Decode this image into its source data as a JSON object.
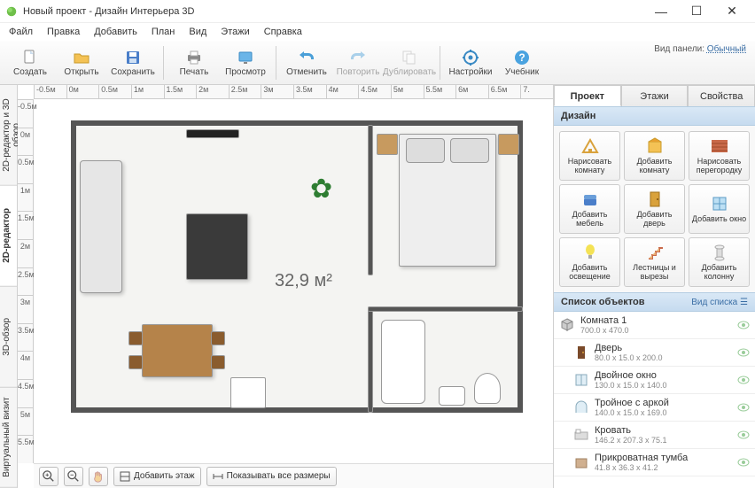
{
  "title": "Новый проект - Дизайн Интерьера 3D",
  "window": {
    "min": "—",
    "max": "☐",
    "close": "✕"
  },
  "menu": [
    "Файл",
    "Правка",
    "Добавить",
    "План",
    "Вид",
    "Этажи",
    "Справка"
  ],
  "toolbar": {
    "create": "Создать",
    "open": "Открыть",
    "save": "Сохранить",
    "print": "Печать",
    "view": "Просмотр",
    "undo": "Отменить",
    "redo": "Повторить",
    "duplicate": "Дублировать",
    "settings": "Настройки",
    "help": "Учебник"
  },
  "viewpanel": {
    "label": "Вид панели:",
    "value": "Обычный"
  },
  "left_tabs": [
    "2D-редактор и 3D обзор",
    "2D-редактор",
    "3D-обзор",
    "Виртуальный визит"
  ],
  "ruler_h": [
    "-0.5м",
    "0м",
    "0.5м",
    "1м",
    "1.5м",
    "2м",
    "2.5м",
    "3м",
    "3.5м",
    "4м",
    "4.5м",
    "5м",
    "5.5м",
    "6м",
    "6.5м",
    "7."
  ],
  "ruler_v": [
    "-0.5м",
    "0м",
    "0.5м",
    "1м",
    "1.5м",
    "2м",
    "2.5м",
    "3м",
    "3.5м",
    "4м",
    "4.5м",
    "5м",
    "5.5м"
  ],
  "area_label": "32,9 м²",
  "footer": {
    "add_floor": "Добавить этаж",
    "show_all": "Показывать все размеры"
  },
  "rtabs": [
    "Проект",
    "Этажи",
    "Свойства"
  ],
  "design_header": "Дизайн",
  "design": [
    "Нарисовать комнату",
    "Добавить комнату",
    "Нарисовать перегородку",
    "Добавить мебель",
    "Добавить дверь",
    "Добавить окно",
    "Добавить освещение",
    "Лестницы и вырезы",
    "Добавить колонну"
  ],
  "objects_header": "Список объектов",
  "objects_view": "Вид списка",
  "objects": [
    {
      "name": "Комната 1",
      "dims": "700.0 x 470.0",
      "indent": false,
      "icon": "cube"
    },
    {
      "name": "Дверь",
      "dims": "80.0 x 15.0 x 200.0",
      "indent": true,
      "icon": "door"
    },
    {
      "name": "Двойное окно",
      "dims": "130.0 x 15.0 x 140.0",
      "indent": true,
      "icon": "window"
    },
    {
      "name": "Тройное с аркой",
      "dims": "140.0 x 15.0 x 169.0",
      "indent": true,
      "icon": "arch"
    },
    {
      "name": "Кровать",
      "dims": "146.2 x 207.3 x 75.1",
      "indent": true,
      "icon": "bed"
    },
    {
      "name": "Прикроватная тумба",
      "dims": "41.8 x 36.3 x 41.2",
      "indent": true,
      "icon": "box"
    }
  ]
}
